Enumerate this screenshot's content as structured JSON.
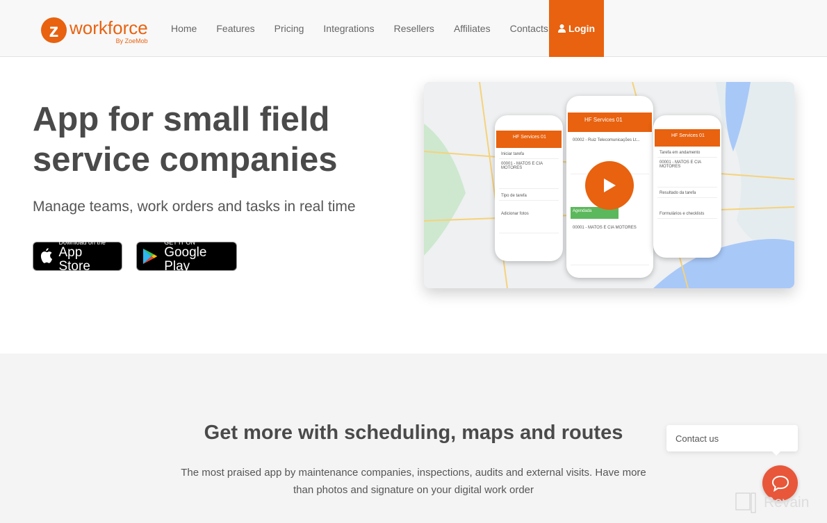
{
  "brand": {
    "logo_letter": "z",
    "name": "workforce",
    "tagline": "By ZoeMob",
    "accent": "#e8620f"
  },
  "nav": {
    "items": [
      "Home",
      "Features",
      "Pricing",
      "Integrations",
      "Resellers",
      "Affiliates",
      "Contacts"
    ],
    "login": "Login"
  },
  "hero": {
    "title": "App for small field service companies",
    "subtitle": "Manage teams, work orders and tasks in real time",
    "app_store": {
      "small": "Download on the",
      "big": "App Store"
    },
    "google_play": {
      "small": "GET IT ON",
      "big": "Google Play"
    }
  },
  "video": {
    "app_title": "HF Services 01",
    "left_items": [
      "Iniciar tarefa",
      "00001 - MATOS E CIA MOTORES",
      "Tipo de tarefa",
      "Adicionar fotos"
    ],
    "center_items": [
      "00002 - Ruiz Telecomunicações Lt...",
      "Agendada",
      "00001 - MATOS E CIA MOTORES"
    ],
    "right_items": [
      "Tarefa em andamento",
      "00001 - MATOS E CIA MOTORES",
      "Resultado da tarefa",
      "Formulários e checklists"
    ]
  },
  "section2": {
    "title": "Get more with scheduling, maps and routes",
    "text": "The most praised app by maintenance companies, inspections, audits and external visits. Have more than photos and signature on your digital work order"
  },
  "chat": {
    "bubble": "Contact us"
  },
  "watermark": "Revain"
}
